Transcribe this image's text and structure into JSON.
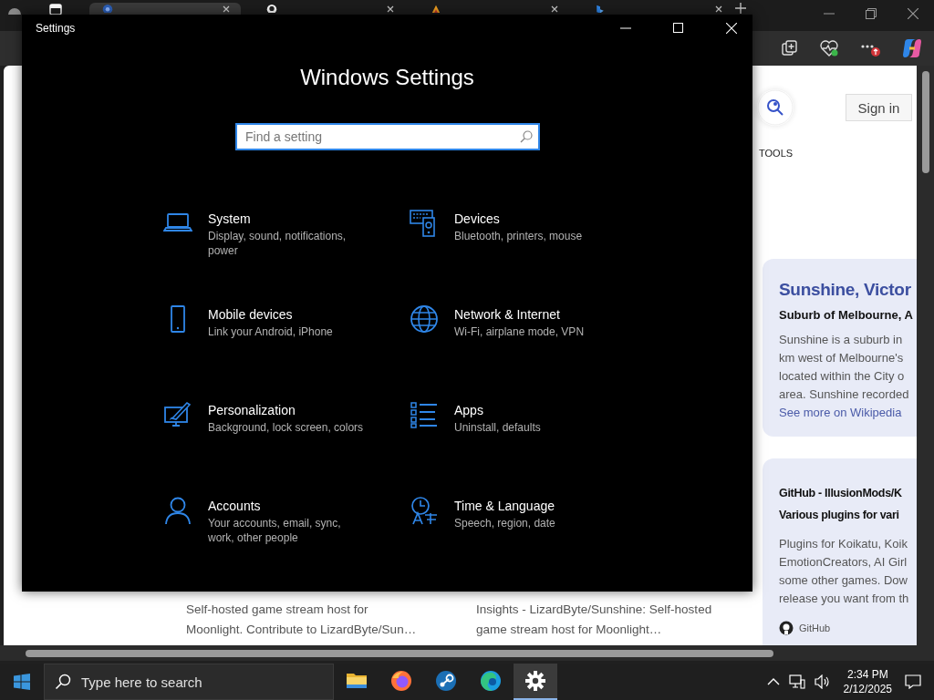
{
  "browser": {
    "tabs": [
      {
        "selected": true
      },
      {
        "selected": false
      },
      {
        "selected": false
      },
      {
        "selected": false
      }
    ],
    "content": {
      "sign_in": "Sign in",
      "tools": "TOOLS",
      "snippets": [
        {
          "lines": [
            "Self-hosted game stream host for",
            "Moonlight. Contribute to LizardByte/Sun…"
          ]
        },
        {
          "lines": [
            "Insights - LizardByte/Sunshine: Self-hosted",
            "game stream host for Moonlight…"
          ]
        }
      ],
      "cards": [
        {
          "kind": "wiki",
          "title_lines": [
            "Sunshine, Victor"
          ],
          "subtitle": "Suburb of Melbourne, A",
          "lines": [
            "Sunshine is a suburb in",
            "km west of Melbourne's",
            "located within the City o",
            "area. Sunshine recorded"
          ],
          "link": "See more on Wikipedia"
        },
        {
          "kind": "result",
          "title_lines": [
            "GitHub - IllusionMods/K",
            "Various plugins for vari"
          ],
          "lines": [
            "Plugins for Koikatu, Koik",
            "EmotionCreators, AI Girl",
            "some other games. Dow",
            "release you want from th"
          ],
          "source": "GitHub"
        }
      ]
    }
  },
  "settings_window": {
    "title": "Settings",
    "heading": "Windows Settings",
    "search": {
      "placeholder": "Find a setting"
    },
    "categories": [
      {
        "title": "System",
        "subtitle": "Display, sound, notifications, power"
      },
      {
        "title": "Devices",
        "subtitle": "Bluetooth, printers, mouse"
      },
      {
        "title": "Mobile devices",
        "subtitle": "Link your Android, iPhone"
      },
      {
        "title": "Network & Internet",
        "subtitle": "Wi-Fi, airplane mode, VPN"
      },
      {
        "title": "Personalization",
        "subtitle": "Background, lock screen, colors"
      },
      {
        "title": "Apps",
        "subtitle": "Uninstall, defaults"
      },
      {
        "title": "Accounts",
        "subtitle": "Your accounts, email, sync, work, other people"
      },
      {
        "title": "Time & Language",
        "subtitle": "Speech, region, date"
      }
    ]
  },
  "taskbar": {
    "search": {
      "placeholder": "Type here to search"
    },
    "apps": [
      {
        "active": false
      },
      {
        "active": false
      },
      {
        "active": false
      },
      {
        "active": false
      },
      {
        "active": true
      }
    ],
    "clock": {
      "time": "2:34 PM",
      "date": "2/12/2025"
    }
  }
}
